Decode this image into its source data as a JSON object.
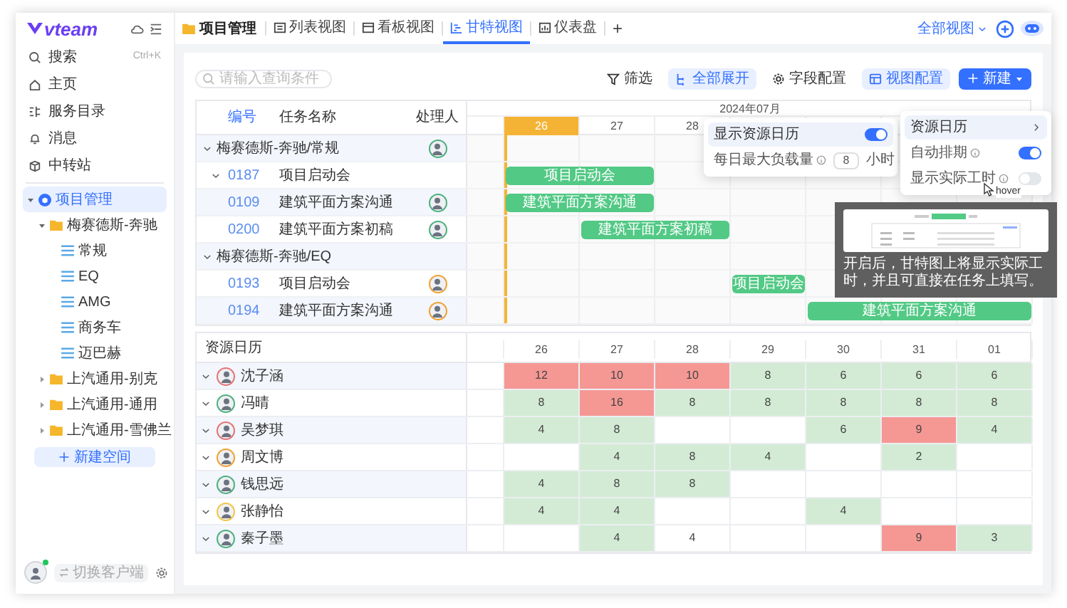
{
  "app": {
    "logo": "vteam"
  },
  "sidebar": {
    "nav": [
      {
        "label": "搜索",
        "shortcut": "Ctrl+K"
      },
      {
        "label": "主页"
      },
      {
        "label": "服务目录"
      },
      {
        "label": "消息"
      },
      {
        "label": "中转站"
      }
    ],
    "tree": {
      "label": "项目管理",
      "selected": true,
      "expanded": true,
      "children": [
        {
          "label": "梅赛德斯-奔驰",
          "selected": false,
          "expanded": true,
          "children": [
            {
              "label": "常规",
              "selected": false
            },
            {
              "label": "EQ",
              "selected": false
            },
            {
              "label": "AMG",
              "selected": false
            },
            {
              "label": "商务车",
              "selected": false
            },
            {
              "label": "迈巴赫",
              "selected": false
            }
          ]
        },
        {
          "label": "上汽通用-别克",
          "selected": false,
          "expanded": false
        },
        {
          "label": "上汽通用-通用",
          "selected": false,
          "expanded": false
        },
        {
          "label": "上汽通用-雪佛兰",
          "selected": false,
          "expanded": false
        }
      ]
    },
    "new_space": "新建空间",
    "user": {
      "online": true
    },
    "switch_client": "切换客户端"
  },
  "topbar": {
    "breadcrumb": "项目管理",
    "tabs": [
      {
        "label": "列表视图",
        "selected": false
      },
      {
        "label": "看板视图",
        "selected": false
      },
      {
        "label": "甘特视图",
        "selected": true
      },
      {
        "label": "仪表盘",
        "selected": false
      }
    ],
    "add_tab": "+",
    "views": "全部视图"
  },
  "toolbar": {
    "search": {
      "placeholder": "请输入查询条件"
    },
    "buttons": [
      {
        "label": "筛选",
        "active": false
      },
      {
        "label": "全部展开",
        "active": true
      },
      {
        "label": "字段配置",
        "active": false
      },
      {
        "label": "视图配置",
        "active": true
      }
    ],
    "new": "新建"
  },
  "table": {
    "columns": [
      "编号",
      "任务名称",
      "处理人"
    ],
    "month": "2024年07月",
    "days": [
      {
        "label": "26",
        "today": true
      },
      {
        "label": "27",
        "today": false
      },
      {
        "label": "28",
        "today": false
      }
    ],
    "rows": [
      {
        "kind": "group",
        "title": "梅赛德斯-奔驰/常规",
        "assignee": {
          "color": "#4caf7d"
        },
        "children": [
          {
            "kind": "task",
            "id": "0187",
            "name": "项目启动会",
            "expanded": true,
            "bar": {
              "label": "项目启动会",
              "days": [
                true,
                true,
                false,
                false,
                false,
                false,
                false
              ]
            },
            "children": [
              {
                "kind": "task",
                "id": "0109",
                "name": "建筑平面方案沟通",
                "assignee": {
                  "color": "#4caf7d"
                },
                "bar": {
                  "label": "建筑平面方案沟通",
                  "days": [
                    true,
                    true,
                    false,
                    false,
                    false,
                    false,
                    false
                  ]
                }
              },
              {
                "kind": "task",
                "id": "0200",
                "name": "建筑平面方案初稿",
                "assignee": {
                  "color": "#4caf7d"
                },
                "bar": {
                  "label": "建筑平面方案初稿",
                  "days": [
                    false,
                    true,
                    true,
                    false,
                    false,
                    false,
                    false
                  ]
                }
              }
            ]
          }
        ]
      },
      {
        "kind": "group",
        "title": "梅赛德斯-奔驰/EQ",
        "children": [
          {
            "kind": "task",
            "id": "0193",
            "name": "项目启动会",
            "assignee": {
              "color": "#f0a030"
            },
            "bar": {
              "label": "项目启动会",
              "days": [
                false,
                false,
                false,
                true,
                false,
                false,
                false
              ]
            }
          },
          {
            "kind": "task",
            "id": "0194",
            "name": "建筑平面方案沟通",
            "assignee": {
              "color": "#f0a030"
            },
            "bar": {
              "label": "建筑平面方案沟通",
              "days": [
                false,
                false,
                false,
                false,
                true,
                true,
                true
              ]
            }
          }
        ]
      }
    ]
  },
  "resources": {
    "title": "资源日历",
    "days": [
      "26",
      "27",
      "28",
      "29",
      "30",
      "31",
      "01"
    ],
    "people": [
      {
        "name": "沈子涵",
        "color": "#e57373",
        "cells": [
          {
            "value": "12",
            "over": true
          },
          {
            "value": "10",
            "over": true
          },
          {
            "value": "10",
            "over": true
          },
          {
            "value": "8",
            "booked": true,
            "over": false
          },
          {
            "value": "6",
            "booked": true,
            "over": false
          },
          {
            "value": "6",
            "booked": true,
            "over": false
          },
          {
            "value": "6",
            "booked": true,
            "over": false
          }
        ]
      },
      {
        "name": "冯晴",
        "color": "#4caf7d",
        "cells": [
          {
            "value": "8",
            "booked": true,
            "over": false
          },
          {
            "value": "16",
            "over": true
          },
          {
            "value": "8",
            "booked": true,
            "over": false
          },
          {
            "value": "8",
            "booked": true,
            "over": false
          },
          {
            "value": "8",
            "booked": true,
            "over": false
          },
          {
            "value": "8",
            "booked": true,
            "over": false
          },
          {
            "value": "8",
            "booked": true,
            "over": false
          }
        ]
      },
      {
        "name": "吴梦琪",
        "color": "#e57373",
        "cells": [
          {
            "value": "4",
            "booked": true,
            "over": false
          },
          {
            "value": "8",
            "booked": true,
            "over": false
          },
          {
            "booked": false,
            "over": false
          },
          {
            "booked": false,
            "over": false
          },
          {
            "value": "6",
            "booked": true,
            "over": false
          },
          {
            "value": "9",
            "over": true
          },
          {
            "value": "4",
            "booked": true,
            "over": false
          }
        ]
      },
      {
        "name": "周文博",
        "color": "#f0a030",
        "cells": [
          {
            "booked": false,
            "over": false
          },
          {
            "value": "4",
            "booked": true,
            "over": false
          },
          {
            "value": "8",
            "booked": true,
            "over": false
          },
          {
            "value": "4",
            "booked": true,
            "over": false
          },
          {
            "booked": false,
            "over": false
          },
          {
            "value": "2",
            "booked": true,
            "over": false
          },
          {
            "booked": false,
            "over": false
          }
        ]
      },
      {
        "name": "钱思远",
        "color": "#4caf7d",
        "cells": [
          {
            "value": "4",
            "booked": true,
            "over": false
          },
          {
            "value": "8",
            "booked": true,
            "over": false
          },
          {
            "value": "8",
            "booked": true,
            "over": false
          },
          {
            "booked": false,
            "over": false
          },
          {
            "booked": false,
            "over": false
          },
          {
            "booked": false,
            "over": false
          },
          {
            "booked": false,
            "over": false
          }
        ]
      },
      {
        "name": "张静怡",
        "color": "#f5c542",
        "cells": [
          {
            "value": "4",
            "booked": true,
            "over": false
          },
          {
            "value": "4",
            "booked": true,
            "over": false
          },
          {
            "booked": false,
            "over": false
          },
          {
            "booked": false,
            "over": false
          },
          {
            "value": "4",
            "booked": true,
            "over": false
          },
          {
            "booked": false,
            "over": false
          },
          {
            "booked": false,
            "over": false
          }
        ]
      },
      {
        "name": "秦子墨",
        "color": "#4caf7d",
        "cells": [
          {
            "booked": false,
            "over": false
          },
          {
            "value": "4",
            "booked": true,
            "over": false
          },
          {
            "value": "4",
            "booked": false,
            "over": false
          },
          {
            "booked": false,
            "over": false
          },
          {
            "booked": false,
            "over": false
          },
          {
            "value": "9",
            "over": true
          },
          {
            "value": "3",
            "booked": true,
            "over": false
          }
        ]
      }
    ]
  },
  "resource_popover": {
    "toggle": {
      "label": "显示资源日历",
      "on": true
    },
    "max_load": {
      "label": "每日最大负载量",
      "value": "8",
      "unit": "小时"
    }
  },
  "view_menu": {
    "header": "资源日历",
    "items": [
      {
        "label": "自动排期",
        "on": true
      },
      {
        "label": "显示实际工时",
        "on": false
      }
    ]
  },
  "tooltip": {
    "cursor_label": "hover",
    "text": "开启后，甘特图上将显示实际工时，并且可直接在任务上填写。"
  }
}
